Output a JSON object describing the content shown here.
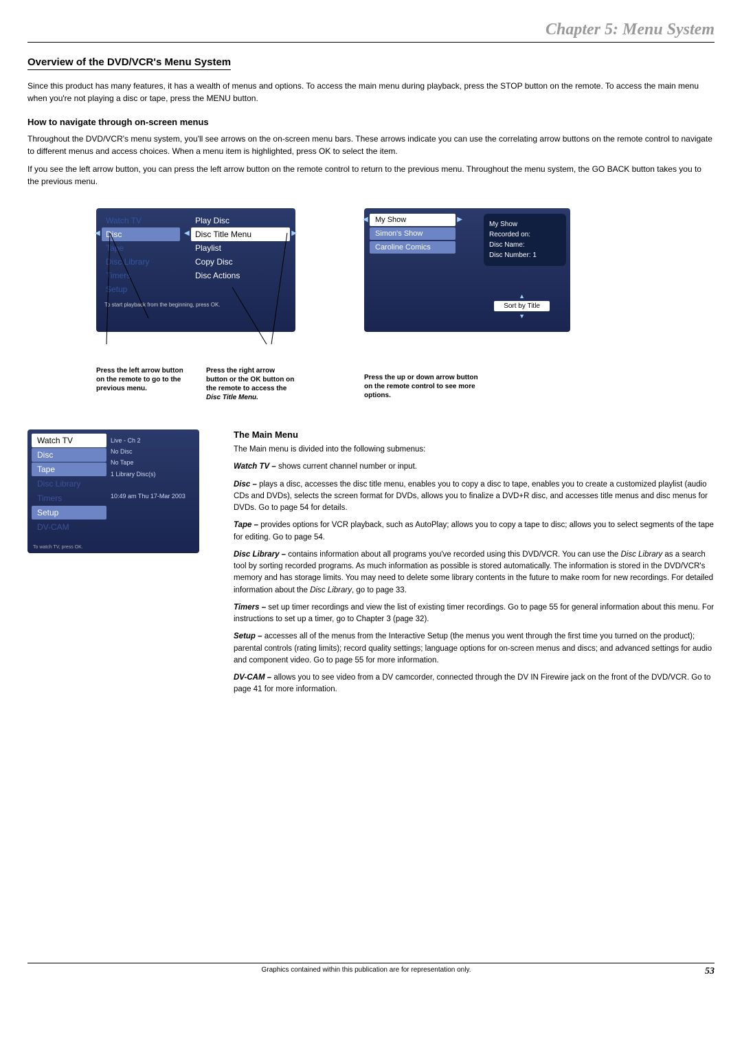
{
  "chapter_title": "Chapter 5: Menu System",
  "section_title": "Overview of the DVD/VCR's Menu System",
  "intro": "Since this product has many features, it has a wealth of menus and options. To access the main menu during playback, press the STOP button on the remote. To access the main menu when you're not playing a disc or tape, press the MENU button.",
  "nav_heading": "How to navigate through on-screen menus",
  "nav_p1": "Throughout the DVD/VCR's menu system, you'll see arrows on the on-screen menu bars. These arrows indicate you can use the correlating arrow buttons on the remote control to navigate to different menus and access choices. When a menu item is highlighted, press OK to select the item.",
  "nav_p2": "If you see the left arrow button, you can press the left arrow button on the remote control to return to the previous menu. Throughout the menu system, the GO BACK button takes you to the previous menu.",
  "osd1": {
    "left": [
      "Watch TV",
      "Disc",
      "Tape",
      "Disc Library",
      "Timers",
      "Setup"
    ],
    "right": [
      "Play Disc",
      "Disc Title Menu",
      "Playlist",
      "Copy Disc",
      "Disc Actions"
    ],
    "hint": "To start playback from the beginning, press OK.",
    "cap_left": "Press the left arrow button on the remote to go to the previous menu.",
    "cap_right_1": "Press the right arrow button or the OK button on the remote to access the ",
    "cap_right_2": "Disc Title Menu."
  },
  "osd2": {
    "items": [
      "My Show",
      "Simon's Show",
      "Caroline Comics"
    ],
    "info_title": "My Show",
    "info_rec": "Recorded on:",
    "info_name": "Disc Name:",
    "info_num": "Disc Number: 1",
    "sort": "Sort by Title",
    "cap": "Press the up or down arrow button on the remote control to see more options."
  },
  "mm": {
    "left": [
      "Watch TV",
      "Disc",
      "Tape",
      "Disc Library",
      "Timers",
      "Setup",
      "DV-CAM"
    ],
    "right": [
      "Live - Ch 2",
      "No Disc",
      "No Tape",
      "1 Library Disc(s)",
      "",
      "10:49 am Thu 17-Mar 2003",
      ""
    ],
    "hint": "To watch TV, press OK."
  },
  "main_heading": "The Main Menu",
  "main_intro": "The Main menu is divided into the following submenus:",
  "desc": {
    "watchtv_label": "Watch TV –",
    "watchtv": " shows current channel number or input.",
    "disc_label": "Disc –",
    "disc": " plays a disc, accesses the disc title menu, enables you to copy a disc to tape, enables you to create a customized playlist (audio CDs and DVDs), selects the screen format for DVDs, allows you to finalize a DVD+R disc, and accesses title menus and disc menus for DVDs. Go to page 54 for details.",
    "tape_label": "Tape –",
    "tape": " provides options for VCR playback, such as AutoPlay; allows you to copy a tape to disc; allows you to select segments of the tape for editing. Go to page 54.",
    "lib_label": "Disc Library –",
    "lib_1": " contains information about all programs you've recorded using this DVD/VCR. You can use the ",
    "lib_2": "Disc Library",
    "lib_3": " as a search tool by sorting recorded programs. As much information as possible is stored automatically. The information is stored in the DVD/VCR's memory and has storage limits. You may need to delete some library contents in the future to make room for new recordings. For detailed information about the ",
    "lib_4": "Disc Library",
    "lib_5": ", go to page 33.",
    "timers_label": "Timers –",
    "timers": " set up timer recordings and view the list of existing timer recordings. Go to page 55 for general information about this menu. For instructions to set up a timer, go to Chapter 3 (page 32).",
    "setup_label": "Setup –",
    "setup": " accesses all of the menus from the Interactive Setup (the menus you went through the first time you turned on the product); parental controls (rating limits); record quality settings; language options for on-screen menus and discs; and advanced settings for audio and component video. Go to page 55 for more information.",
    "dvcam_label": "DV-CAM –",
    "dvcam": " allows you to see video from a DV camcorder, connected through the DV IN Firewire jack on the front of the DVD/VCR.  Go to page 41 for more information."
  },
  "footer_center": "Graphics contained within this publication are for representation only.",
  "page_number": "53"
}
